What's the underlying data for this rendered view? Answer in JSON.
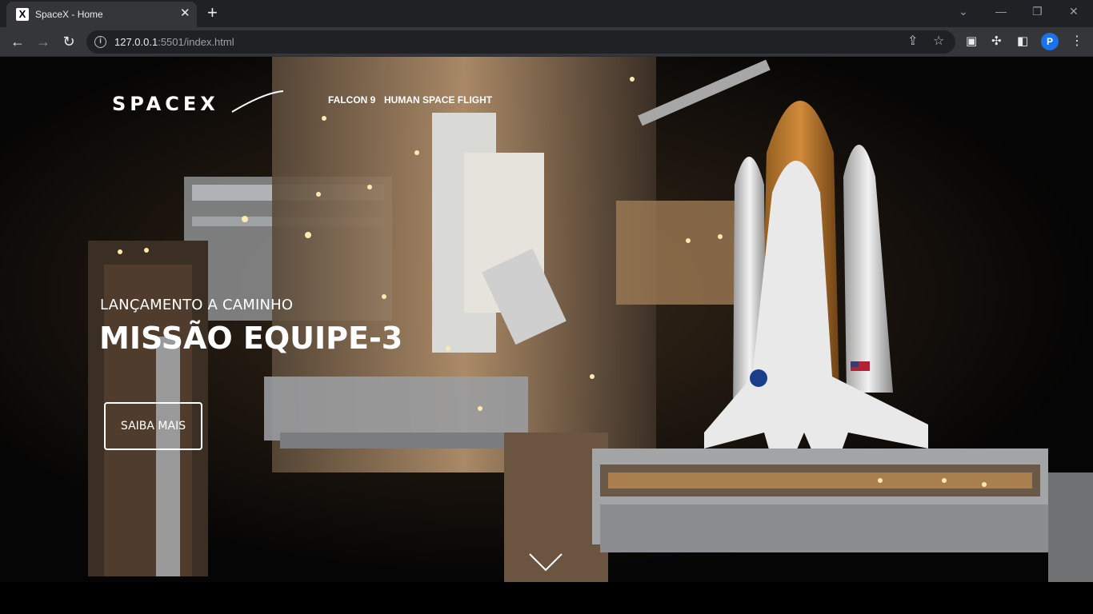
{
  "browser": {
    "tab_title": "SpaceX - Home",
    "favicon_glyph": "X",
    "url_host": "127.0.0.1",
    "url_rest": ":5501/index.html",
    "profile_initial": "P",
    "icons": {
      "back": "back-arrow-icon",
      "forward": "forward-arrow-icon",
      "reload": "reload-icon",
      "info": "info-icon",
      "share": "share-icon",
      "star": "bookmark-star-icon",
      "picture_in_picture": "media-icon",
      "extensions": "puzzle-icon",
      "sidebar": "side-panel-icon",
      "menu": "kebab-menu-icon"
    }
  },
  "site": {
    "logo_text": "SPACEX",
    "nav": [
      {
        "label": "FALCON 9"
      },
      {
        "label": "HUMAN SPACE FLIGHT"
      }
    ],
    "hero": {
      "subtitle": "LANÇAMENTO A CAMINHO",
      "title": "MISSÃO EQUIPE-3",
      "cta_label": "SAIBA MAIS"
    }
  },
  "colors": {
    "chrome_dark": "#202124",
    "chrome_toolbar": "#35363a",
    "accent_blue": "#1a73e8",
    "hero_text": "#ffffff"
  }
}
